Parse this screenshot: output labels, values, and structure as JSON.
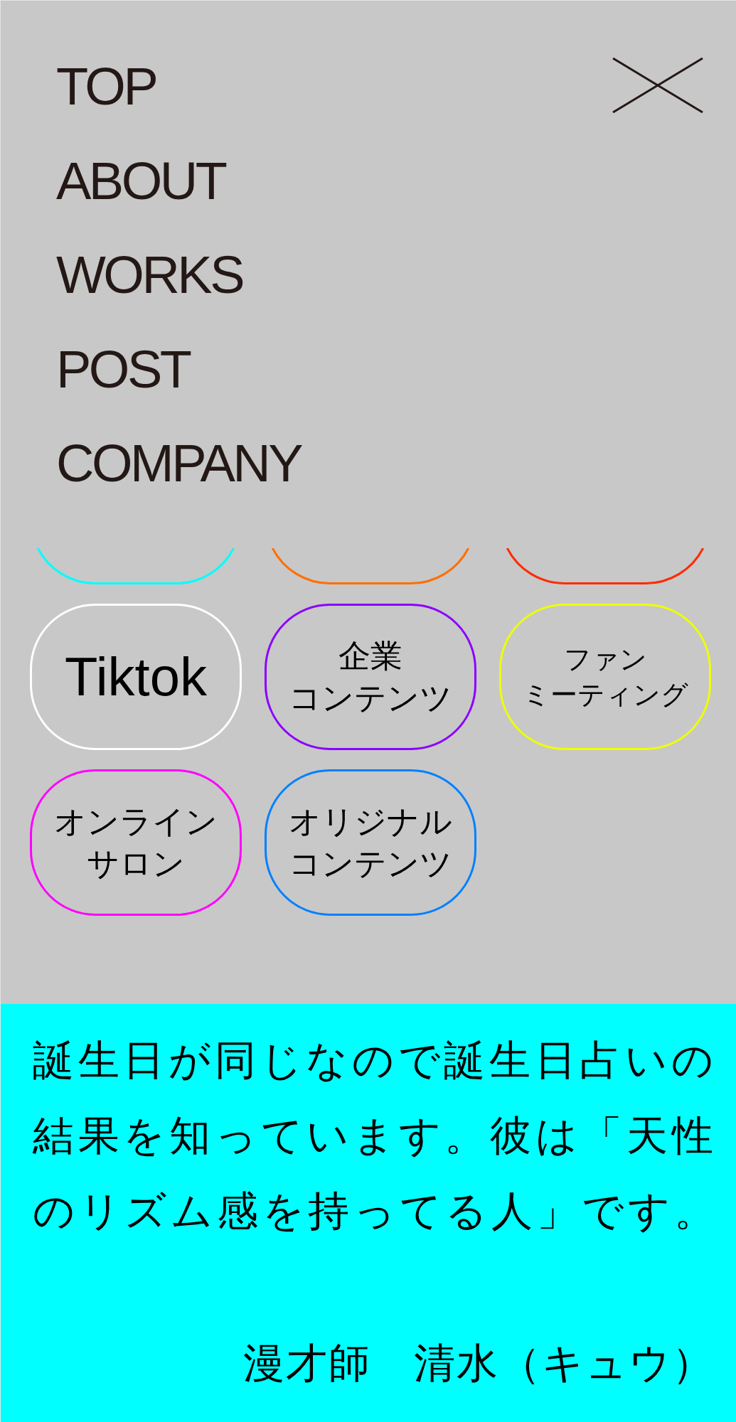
{
  "menu": {
    "items": [
      "TOP",
      "ABOUT",
      "WORKS",
      "POST",
      "COMPANY"
    ]
  },
  "categories": [
    {
      "kind": "clipped",
      "color": "#00ffff"
    },
    {
      "kind": "clipped",
      "color": "#ff6e00"
    },
    {
      "kind": "clipped",
      "color": "#ff2a00"
    },
    {
      "kind": "pill",
      "label": "Tiktok",
      "color": "#ffffff"
    },
    {
      "kind": "pill",
      "label": "企業コンテンツ",
      "color": "#8c00ff"
    },
    {
      "kind": "pill",
      "label": "ファンミーティング",
      "color": "#eeff00"
    },
    {
      "kind": "pill",
      "label": "オンラインサロン",
      "color": "#ff00ff"
    },
    {
      "kind": "pill",
      "label": "オリジナルコンテンツ",
      "color": "#0080ff"
    }
  ],
  "quote": {
    "text": "誕生日が同じなので誕生日占いの結果を知っています。彼は「天性のリズム感を持ってる人」です。",
    "attribution": "漫才師　清水（キュウ）"
  }
}
